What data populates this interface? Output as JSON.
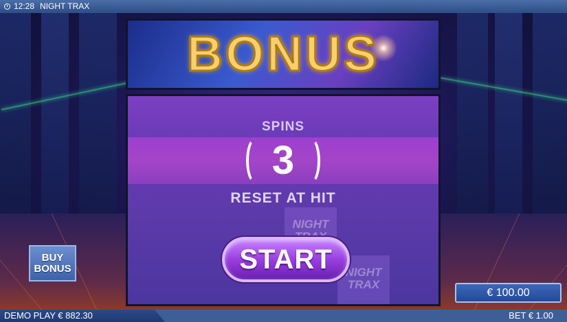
{
  "topbar": {
    "time": "12:28",
    "game_title": "NIGHT TRAX"
  },
  "banner": {
    "title": "BONUS"
  },
  "panel": {
    "spins_label": "SPINS",
    "spins_count": "3",
    "reset_label": "RESET AT HIT",
    "start_label": "START",
    "logo_line1": "NIGHT",
    "logo_line2": "TRAX"
  },
  "buy_bonus": {
    "line1": "BUY",
    "line2": "BONUS"
  },
  "balance": {
    "label": "€ 100.00"
  },
  "bottombar": {
    "demo_label": "DEMO PLAY",
    "demo_amount": "€ 882.30",
    "bet_label": "BET",
    "bet_amount": "€ 1.00"
  },
  "icons": {
    "clock": "clock-icon"
  }
}
